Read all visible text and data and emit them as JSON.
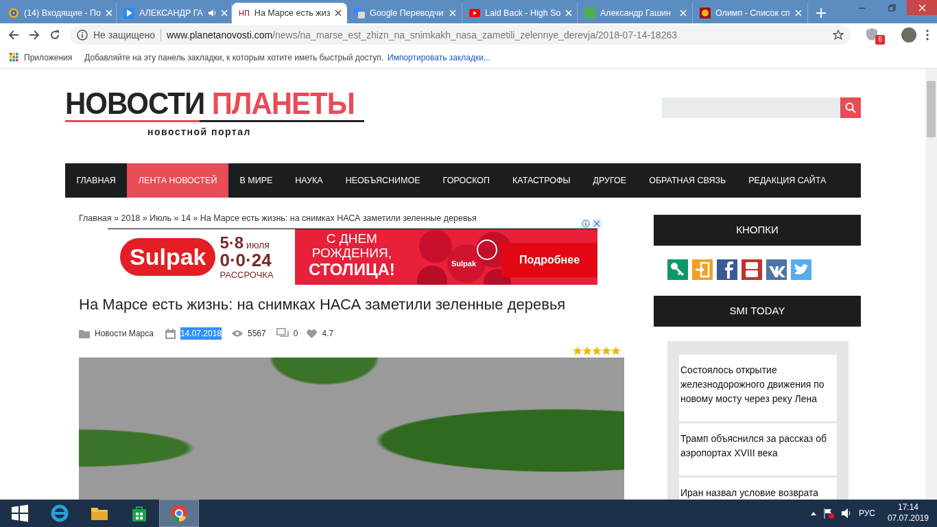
{
  "browser": {
    "tabs": [
      {
        "title": "(14) Входящие - По",
        "kind": "mail",
        "selected": false,
        "playing_audio": false
      },
      {
        "title": "АЛЕКСАНДР ГА",
        "kind": "play",
        "selected": false,
        "playing_audio": true
      },
      {
        "title": "На Марсе есть жиз",
        "kind": "text",
        "favicon_text": "НП",
        "selected": true,
        "playing_audio": false
      },
      {
        "title": "Google Переводчи",
        "kind": "translate",
        "selected": false,
        "playing_audio": false
      },
      {
        "title": "Laid Back - High So",
        "kind": "video",
        "selected": false,
        "playing_audio": false
      },
      {
        "title": "Александр Гашин",
        "kind": "square",
        "selected": false,
        "playing_audio": false
      },
      {
        "title": "Олимп - Список сп",
        "kind": "emblem",
        "selected": false,
        "playing_audio": false
      }
    ],
    "address": {
      "security": "Не защищено",
      "host": "www.planetanovosti.com",
      "path": "/news/na_marse_est_zhizn_na_snimkakh_nasa_zametili_zelennye_derevja/2018-07-14-18263"
    },
    "extension_badge": "6",
    "bookmarks_bar": {
      "apps": "Приложения",
      "hint": "Добавляйте на эту панель закладки, к которым хотите иметь быстрый доступ.",
      "import_link": "Импортировать закладки..."
    }
  },
  "site": {
    "logo": {
      "word_1": "НОВОСТИ",
      "word_2": "ПЛАНЕТЫ",
      "tagline": "новостной портал"
    },
    "nav": [
      {
        "label": "ГЛАВНАЯ",
        "selected": false
      },
      {
        "label": "ЛЕНТА НОВОСТЕЙ",
        "selected": true
      },
      {
        "label": "В МИРЕ",
        "selected": false
      },
      {
        "label": "НАУКА",
        "selected": false
      },
      {
        "label": "НЕОБЪЯСНИМОЕ",
        "selected": false
      },
      {
        "label": "ГОРОСКОП",
        "selected": false
      },
      {
        "label": "КАТАСТРОФЫ",
        "selected": false
      },
      {
        "label": "ДРУГОЕ",
        "selected": false
      },
      {
        "label": "ОБРАТНАЯ СВЯЗЬ",
        "selected": false
      },
      {
        "label": "РЕДАКЦИЯ САЙТА",
        "selected": false
      }
    ],
    "breadcrumb": {
      "links": [
        "Главная",
        "2018",
        "Июль",
        "14"
      ],
      "separator": "»",
      "current": "На Марсе есть жизнь: на снимках НАСА заметили зеленные деревья"
    },
    "ad": {
      "brand": "Sulpak",
      "dates": "5·8",
      "month": "июля",
      "terms": "0·0·24",
      "installment": "РАССРОЧКА",
      "greeting_1": "С ДНЕМ",
      "greeting_2": "РОЖДЕНИЯ,",
      "greeting_3": "СТОЛИЦА!",
      "balloon_label": "Sulpak",
      "cta": "Подробнее"
    },
    "article": {
      "title": "На Марсе есть жизнь: на снимках НАСА заметили зеленные деревья",
      "category": "Новости Марса",
      "date": "14.07.2018",
      "date_selected": true,
      "views": "5567",
      "comments": "0",
      "rating": "4.7",
      "stars": 5
    },
    "sidebar": {
      "buttons_title": "КНОПКИ",
      "smi_title": "SMI TODAY",
      "smi_items": [
        "Состоялось открытие железнодорожного движения по новому мосту через реку Лена",
        "Трамп объяснился за рассказ об аэропортах XVIII века",
        "Иран назвал условие возврата"
      ]
    }
  },
  "taskbar": {
    "language": "РУС",
    "time": "17:14",
    "date": "07.07.2019"
  }
}
